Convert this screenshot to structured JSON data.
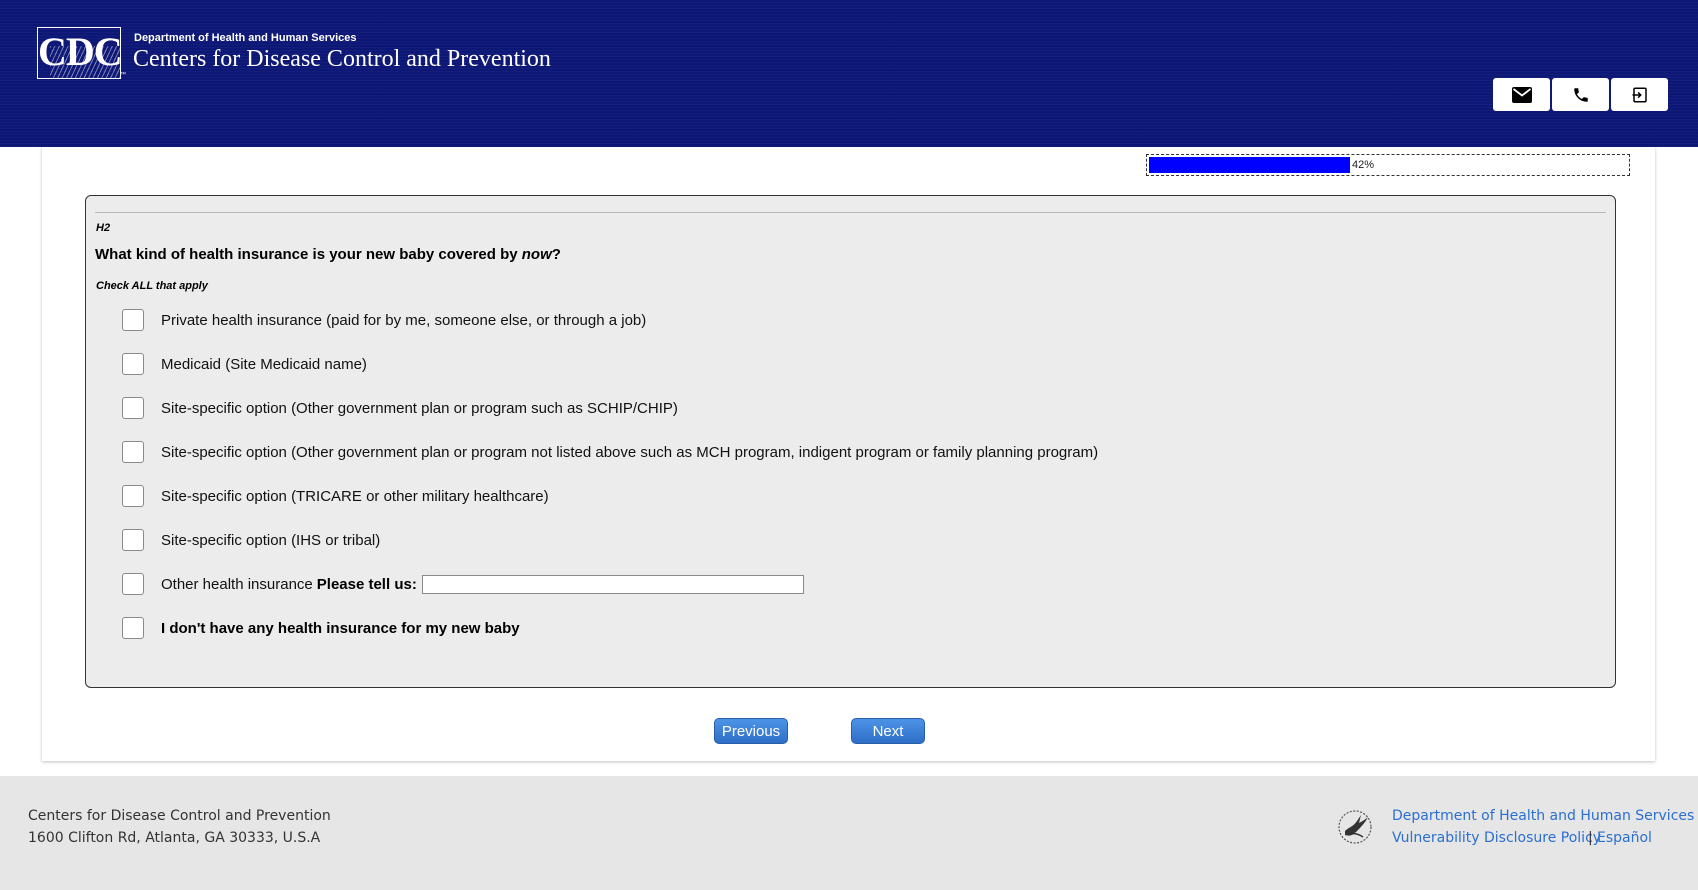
{
  "header": {
    "logo_text": "CDC",
    "logo_tm": "™",
    "department": "Department of Health and Human Services",
    "agency": "Centers for Disease Control and Prevention",
    "buttons": [
      {
        "icon": "mail-icon"
      },
      {
        "icon": "phone-icon"
      },
      {
        "icon": "logout-icon"
      }
    ]
  },
  "progress": {
    "percent": 42,
    "label": "42%"
  },
  "question": {
    "id": "H2",
    "text_before": "What kind of health insurance is your new baby covered by ",
    "text_emphasis": "now",
    "text_after": "?",
    "instruction": "Check ALL that apply",
    "options": [
      {
        "label": "Private health insurance (paid for by me, someone else, or through a job)",
        "checked": false
      },
      {
        "label": "Medicaid (Site Medicaid name)",
        "checked": false
      },
      {
        "label": "Site-specific option (Other government plan or program such as SCHIP/CHIP)",
        "checked": false
      },
      {
        "label": "Site-specific option (Other government plan or program not listed above such as MCH program, indigent program or family planning program)",
        "checked": false
      },
      {
        "label": "Site-specific option (TRICARE or other military healthcare)",
        "checked": false
      },
      {
        "label": "Site-specific option (IHS or tribal)",
        "checked": false
      },
      {
        "label": "Other health insurance",
        "tell_label": "Please tell us:",
        "tell_value": "",
        "checked": false
      },
      {
        "label": "I don't have any health insurance for my new baby",
        "checked": false
      }
    ]
  },
  "nav": {
    "previous_label": "Previous",
    "next_label": "Next"
  },
  "footer": {
    "org": "Centers for Disease Control and Prevention",
    "address": "1600 Clifton Rd, Atlanta, GA 30333, U.S.A",
    "links": {
      "hhs": "Department of Health and Human Services",
      "vdp": "Vulnerability Disclosure Policy",
      "separator": "|",
      "espanol": "Español"
    }
  },
  "colors": {
    "header_bg": "#0d1776",
    "progress_fill": "#0000ff",
    "button_blue": "#3a80d9",
    "link": "#2a6fd1"
  }
}
